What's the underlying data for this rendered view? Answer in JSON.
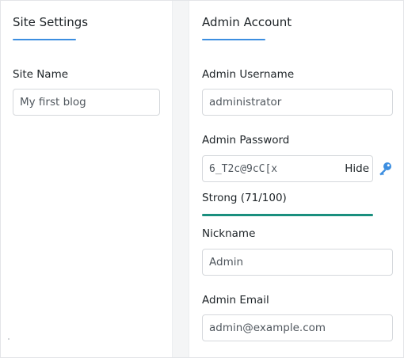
{
  "site_settings": {
    "title": "Site Settings",
    "site_name_label": "Site Name",
    "site_name_value": "My first blog"
  },
  "admin_account": {
    "title": "Admin Account",
    "username_label": "Admin Username",
    "username_value": "administrator",
    "password_label": "Admin Password",
    "password_value": "6_T2c@9cC[x",
    "hide_label": "Hide",
    "strength_text": "Strong (71/100)",
    "strength_score": 71,
    "strength_max": 100,
    "nickname_label": "Nickname",
    "nickname_value": "Admin",
    "email_label": "Admin Email",
    "email_value": "admin@example.com"
  },
  "icons": {
    "password_generator": "key-icon"
  },
  "colors": {
    "accent": "#3c8ee0",
    "strength_strong": "#1a8f7e",
    "key_icon": "#3c8ee0"
  }
}
